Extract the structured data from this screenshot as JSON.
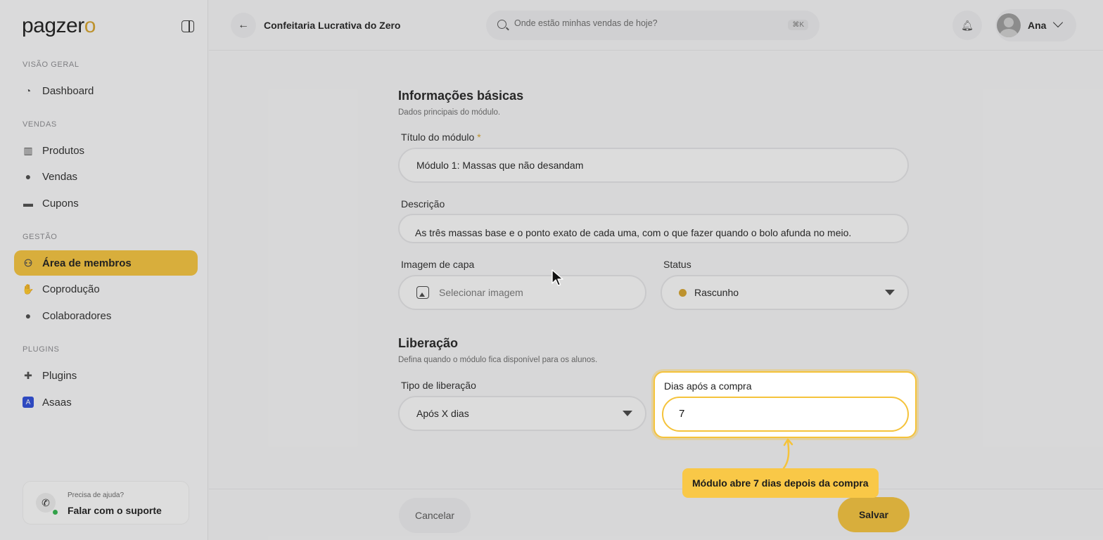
{
  "brand": {
    "logo_text": "pagzer",
    "logo_accent": "o",
    "accent_color": "#f5c33b"
  },
  "sidebar": {
    "sections": [
      {
        "label": "VISÃO GERAL"
      },
      {
        "label": "VENDAS"
      },
      {
        "label": "GESTÃO"
      },
      {
        "label": "PLUGINS"
      }
    ],
    "items": [
      {
        "label": "Dashboard",
        "icon": "dashboard-icon"
      },
      {
        "label": "Produtos",
        "icon": "products-icon"
      },
      {
        "label": "Vendas",
        "icon": "sales-icon"
      },
      {
        "label": "Cupons",
        "icon": "coupon-icon"
      },
      {
        "label": "Área de membros",
        "icon": "members-icon",
        "active": true
      },
      {
        "label": "Coprodução",
        "icon": "handshake-icon"
      },
      {
        "label": "Colaboradores",
        "icon": "user-icon"
      },
      {
        "label": "Plugins",
        "icon": "puzzle-icon"
      },
      {
        "label": "Asaas",
        "icon": "asaas-icon"
      }
    ],
    "help": {
      "small": "Precisa de ajuda?",
      "big": "Falar com o suporte"
    }
  },
  "header": {
    "title": "Confeitaria Lucrativa do Zero",
    "search_placeholder": "Onde estão minhas vendas de hoje?",
    "shortcut": "⌘K",
    "user_name": "Ana"
  },
  "form": {
    "basic": {
      "title": "Informações básicas",
      "subtitle": "Dados principais do módulo."
    },
    "module_title": {
      "label": "Título do módulo",
      "required_mark": "*",
      "value": "Módulo 1: Massas que não desandam"
    },
    "description": {
      "label": "Descrição",
      "value": "As três massas base e o ponto exato de cada uma, com o que fazer quando o bolo afunda no meio."
    },
    "cover": {
      "label": "Imagem de capa",
      "placeholder": "Selecionar imagem"
    },
    "status": {
      "label": "Status",
      "value": "Rascunho",
      "dot_color": "#d4a12a"
    },
    "release": {
      "title": "Liberação",
      "subtitle": "Defina quando o módulo fica disponível para os alunos."
    },
    "release_type": {
      "label": "Tipo de liberação",
      "value": "Após X dias"
    },
    "days_after": {
      "label": "Dias após a compra",
      "value": "7"
    },
    "cancel_label": "Cancelar",
    "save_label": "Salvar"
  },
  "tooltip": {
    "text": "Módulo abre 7 dias depois da compra"
  }
}
